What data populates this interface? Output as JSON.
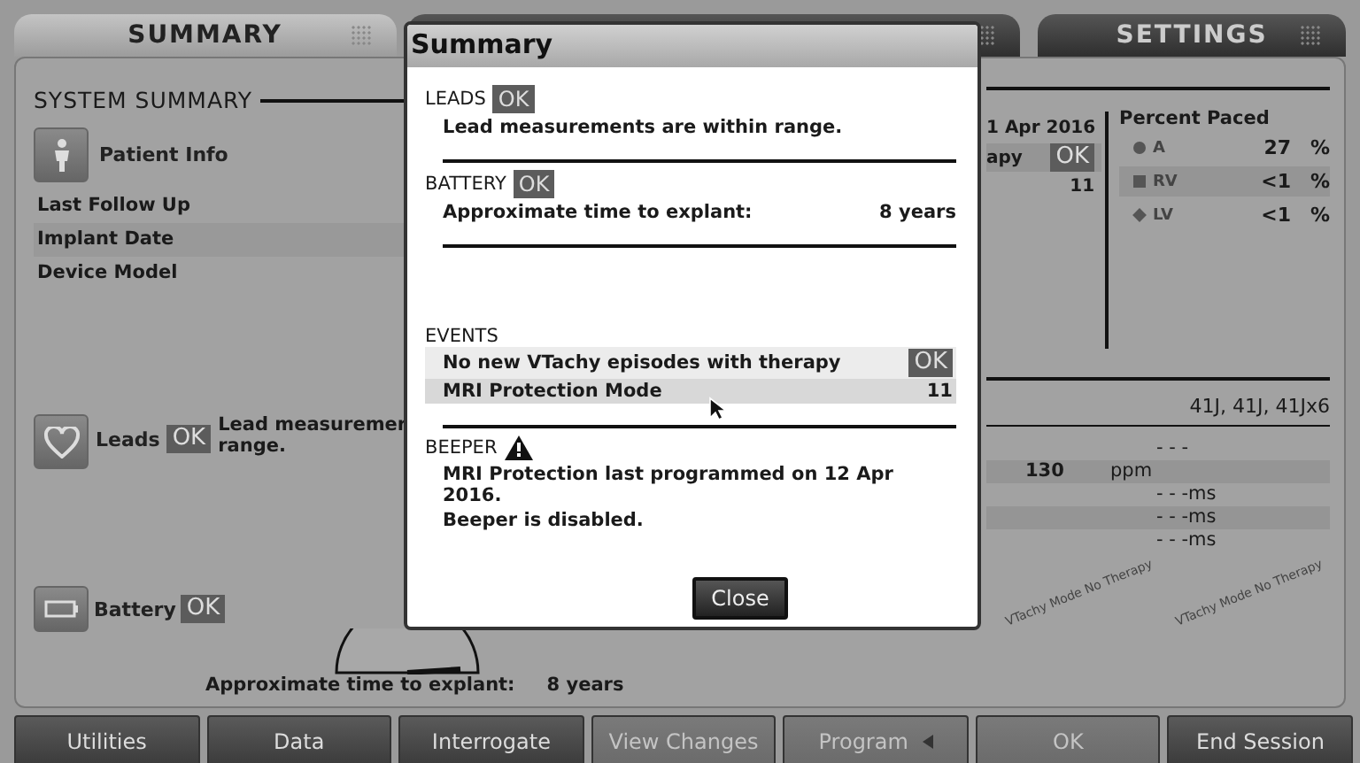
{
  "tabs": [
    {
      "label": "SUMMARY",
      "selected": true
    },
    {
      "label": "SETTINGS",
      "selected": false
    }
  ],
  "system_summary": {
    "title": "SYSTEM SUMMARY",
    "patient_info": "Patient Info",
    "items": [
      "Last Follow Up",
      "Implant Date",
      "Device Model"
    ]
  },
  "info_column": {
    "date": "1 Apr 2016",
    "therapy_label": "apy",
    "therapy_status": "OK",
    "count": "11"
  },
  "percent_paced": {
    "title": "Percent Paced",
    "rows": [
      {
        "kind": "circle",
        "label": "A",
        "value": "27",
        "unit": "%"
      },
      {
        "kind": "square",
        "label": "RV",
        "value": "<1",
        "unit": "%"
      },
      {
        "kind": "diamond",
        "label": "LV",
        "value": "<1",
        "unit": "%"
      }
    ]
  },
  "leads": {
    "label": "Leads",
    "status": "OK",
    "lines": [
      "Lead measuremer",
      "range."
    ]
  },
  "lead_models": "41J, 41J, 41Jx6",
  "parameters": [
    {
      "cells": [
        "- - -"
      ]
    },
    {
      "cells": [
        "130",
        "ppm"
      ]
    },
    {
      "cells": [
        "- - -ms"
      ]
    },
    {
      "cells": [
        "- - -ms"
      ]
    },
    {
      "cells": [
        "- - -ms"
      ]
    }
  ],
  "stamps": [
    "VTachy Mode No Therapy",
    "VTachy Mode No Therapy"
  ],
  "battery": {
    "label": "Battery",
    "status": "OK",
    "time_label": "Approximate time to explant:",
    "time_value": "8 years"
  },
  "dialog": {
    "title": "Summary",
    "sections": [
      {
        "kind": "status",
        "title": "LEADS",
        "status": "OK",
        "lines": [
          {
            "text": "Lead measurements are within range."
          }
        ]
      },
      {
        "kind": "status",
        "title": "BATTERY",
        "status": "OK",
        "lines": [
          {
            "text": "Approximate time to explant:",
            "value": "8 years"
          }
        ]
      },
      {
        "kind": "list",
        "title": "EVENTS",
        "rows": [
          {
            "text": "No new VTachy episodes with therapy",
            "status": "OK"
          },
          {
            "text": "MRI Protection Mode",
            "value": "11"
          }
        ]
      },
      {
        "kind": "warning",
        "title": "BEEPER",
        "lines": [
          {
            "text": "MRI Protection last programmed on 12 Apr 2016."
          },
          {
            "text": "Beeper is disabled."
          }
        ]
      }
    ],
    "close": "Close"
  },
  "buttons": [
    {
      "label": "Utilities",
      "disabled": false
    },
    {
      "label": "Data",
      "disabled": false
    },
    {
      "label": "Interrogate",
      "disabled": false
    },
    {
      "label": "View Changes",
      "disabled": true
    },
    {
      "label": "Program",
      "disabled": true,
      "menu": true
    },
    {
      "label": "OK",
      "disabled": true
    },
    {
      "label": "End Session",
      "disabled": false
    }
  ]
}
